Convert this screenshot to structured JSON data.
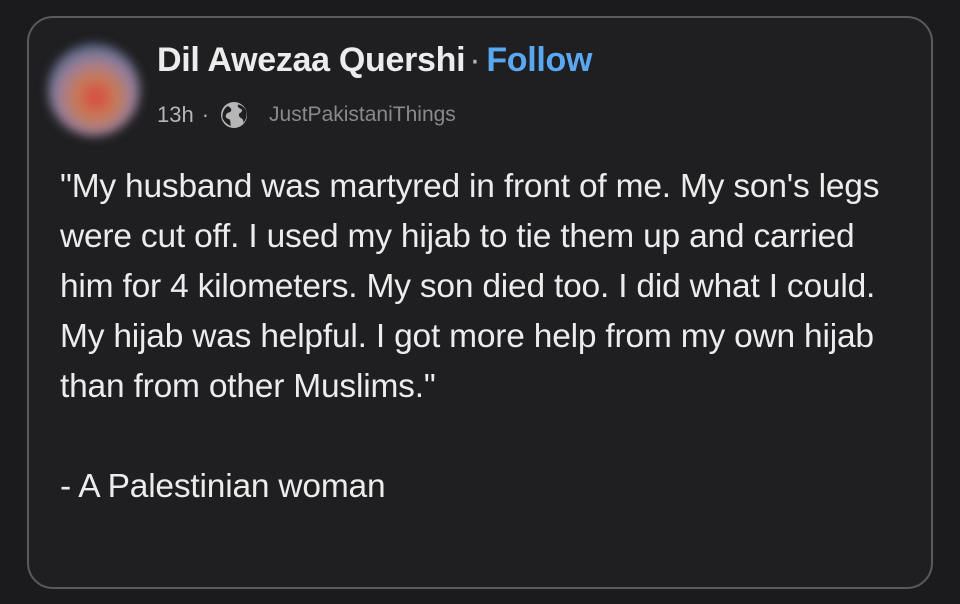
{
  "post": {
    "author_name": "Dil Awezaa Quershi",
    "separator": "·",
    "follow_label": "Follow",
    "time": "13h",
    "meta_separator": "·",
    "audience_icon": "globe-icon",
    "group_name": "JustPakistaniThings",
    "quote": "\"My husband was martyred in front of me. My son's legs were cut off. I used my hijab to tie them up and carried him for 4 kilometers. My son died too. I did what I could. My hijab was helpful. I got more help from my own hijab than from other Muslims.\"",
    "signature": "- A Palestinian woman"
  },
  "colors": {
    "background": "#1b1b1d",
    "card": "#1f1f21",
    "border": "#5a5a5e",
    "follow": "#5aa7f2",
    "text": "#ececec"
  }
}
